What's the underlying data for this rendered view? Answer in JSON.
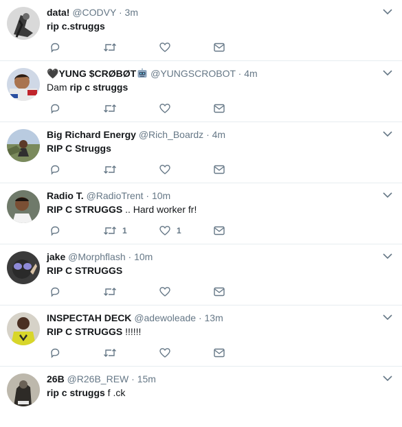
{
  "tweets": [
    {
      "name": "data!",
      "handle": "@CODVY",
      "time": "3m",
      "text_normal": "",
      "text_bold": "rip c.struggs",
      "text_tail": "",
      "retweets": "",
      "likes": ""
    },
    {
      "name": "YUNG $CRØBØT",
      "name_prefix": "🖤",
      "handle": "@YUNGSCROBOT",
      "time": "4m",
      "text_normal": "Dam ",
      "text_bold": "rip c struggs",
      "text_tail": "",
      "retweets": "",
      "likes": ""
    },
    {
      "name": "Big Richard Energy",
      "handle": "@Rich_Boardz",
      "time": "4m",
      "text_normal": "",
      "text_bold": "RIP C Struggs",
      "text_tail": "",
      "retweets": "",
      "likes": ""
    },
    {
      "name": "Radio T.",
      "handle": "@RadioTrent",
      "time": "10m",
      "text_normal": "",
      "text_bold": "RIP C STRUGGS",
      "text_tail": " .. Hard worker fr!",
      "retweets": "1",
      "likes": "1"
    },
    {
      "name": "jake",
      "handle": "@Morphflash",
      "time": "10m",
      "text_normal": "",
      "text_bold": "RIP C STRUGGS",
      "text_tail": "",
      "retweets": "",
      "likes": ""
    },
    {
      "name": "INSPECTAH DECK",
      "handle": "@adewoleade",
      "time": "13m",
      "text_normal": "",
      "text_bold": "RIP C STRUGGS",
      "text_tail": " !!!!!!",
      "retweets": "",
      "likes": ""
    },
    {
      "name": "26B",
      "handle": "@R26B_REW",
      "time": "15m",
      "text_normal": "",
      "text_bold": "rip c struggs",
      "text_tail": " f  .ck",
      "retweets": "",
      "likes": ""
    }
  ],
  "separator": "·",
  "colors": {
    "meta": "#657786",
    "border": "#e6ecf0",
    "text": "#14171a"
  }
}
